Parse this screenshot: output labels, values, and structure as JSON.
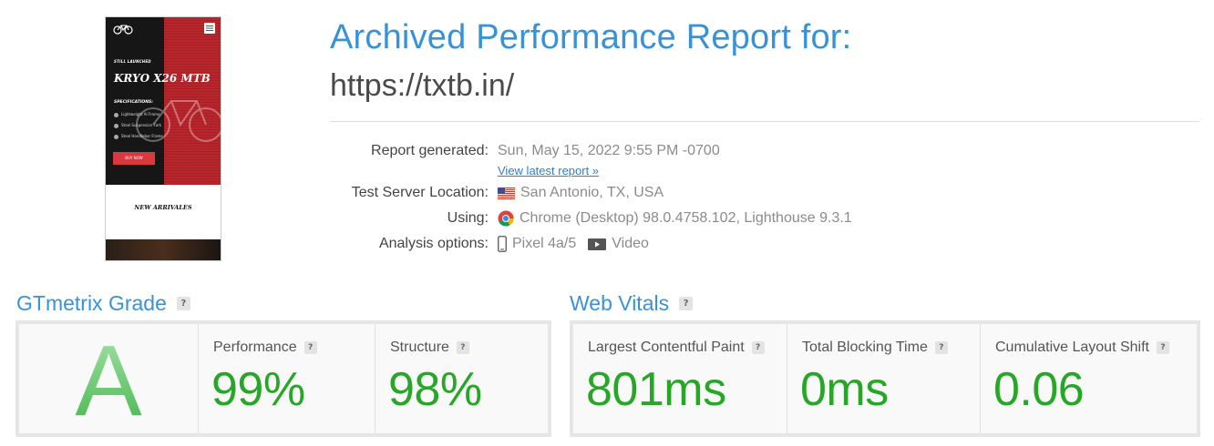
{
  "thumbnail": {
    "tagline": "STILL LAUNCHED",
    "title": "KRYO X26 MTB",
    "specs_heading": "SPECIFICATIONS:",
    "specs": [
      "Lightweight Al Frame",
      "Steel Suspension Fork",
      "Steel Handlebar Frame"
    ],
    "cta": "BUY NOW",
    "section_heading": "NEW ARRIVALES"
  },
  "header": {
    "title": "Archived Performance Report for:",
    "url": "https://txtb.in/"
  },
  "details": {
    "report_generated": {
      "label": "Report generated:",
      "value": "Sun, May 15, 2022 9:55 PM -0700",
      "link": "View latest report »"
    },
    "server_location": {
      "label": "Test Server Location:",
      "value": "San Antonio, TX, USA",
      "icon": "us-flag-icon"
    },
    "using": {
      "label": "Using:",
      "value": "Chrome (Desktop) 98.0.4758.102, Lighthouse 9.3.1",
      "icon": "chrome-icon"
    },
    "analysis": {
      "label": "Analysis options:",
      "device": "Pixel 4a/5",
      "video": "Video"
    }
  },
  "gtmetrix_grade": {
    "title": "GTmetrix Grade",
    "help": "?",
    "grade": "A",
    "performance": {
      "label": "Performance",
      "value": "99%"
    },
    "structure": {
      "label": "Structure",
      "value": "98%"
    }
  },
  "web_vitals": {
    "title": "Web Vitals",
    "help": "?",
    "lcp": {
      "label": "Largest Contentful Paint",
      "value": "801ms"
    },
    "tbt": {
      "label": "Total Blocking Time",
      "value": "0ms"
    },
    "cls": {
      "label": "Cumulative Layout Shift",
      "value": "0.06"
    }
  },
  "colors": {
    "accent_blue": "#3a92d6",
    "good_green": "#27a627",
    "link_blue": "#2b7fd0"
  }
}
